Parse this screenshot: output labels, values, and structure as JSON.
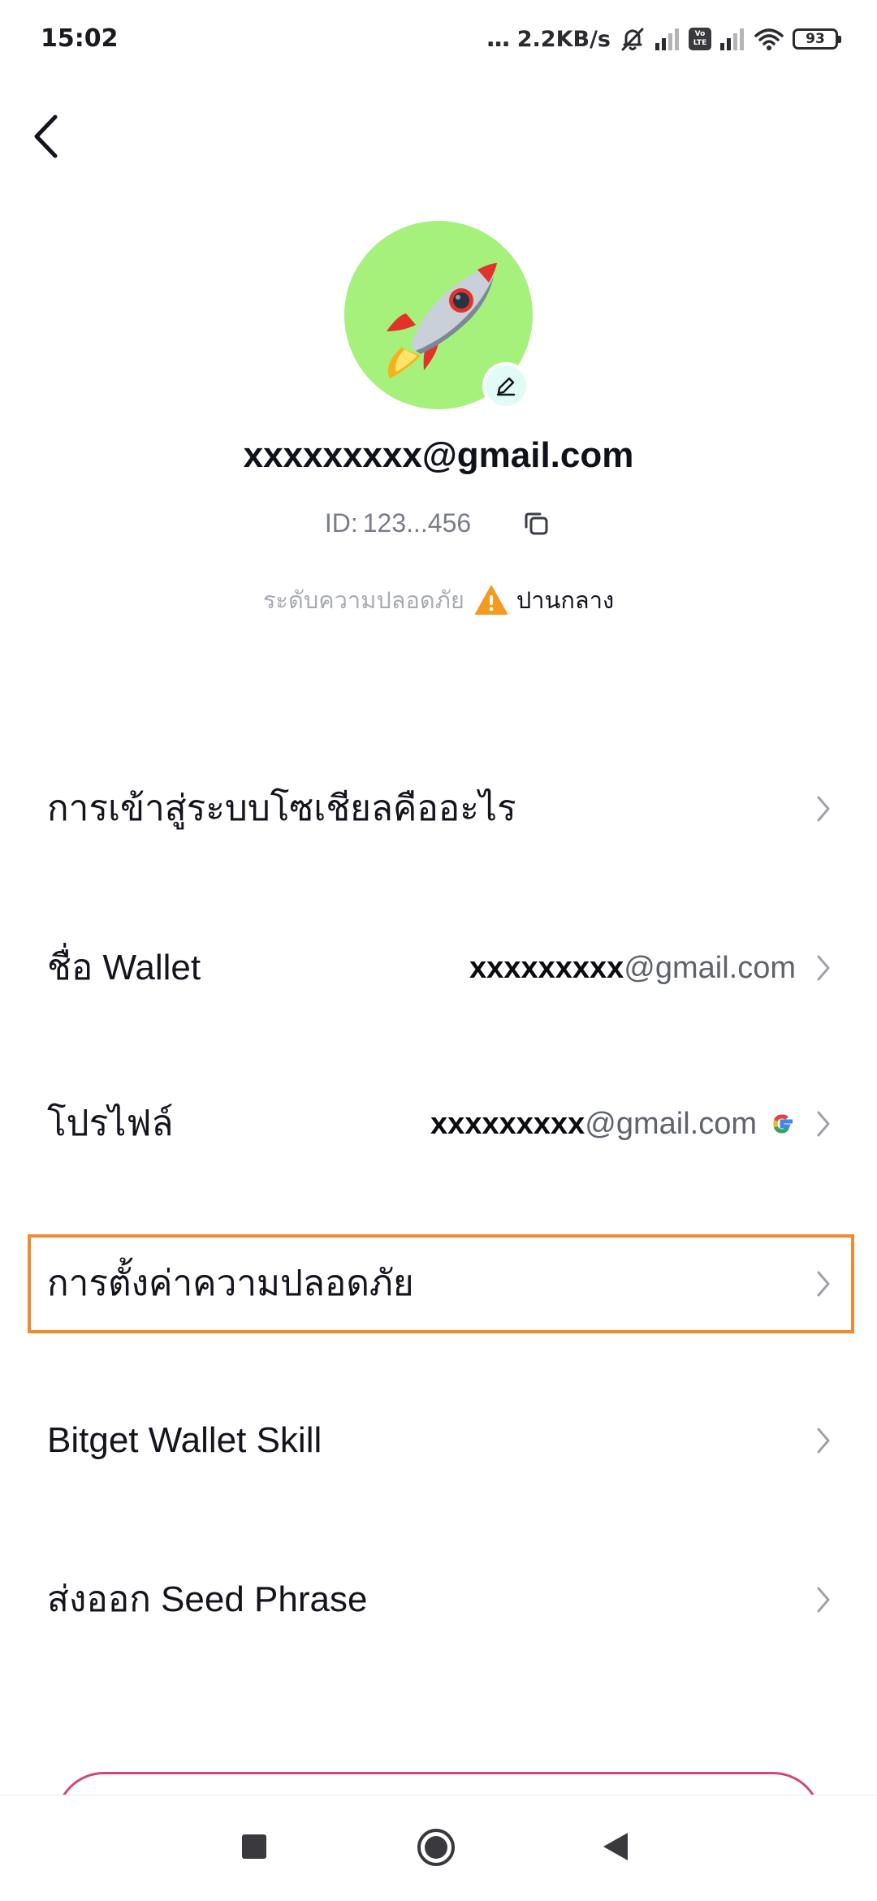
{
  "status_bar": {
    "time": "15:02",
    "dots": "...",
    "network_speed": "2.2KB/s",
    "volte": [
      "Vo",
      "LTE"
    ],
    "battery": "93",
    "icons": [
      "bell-muted-icon",
      "signal-icon",
      "volte-icon",
      "signal-icon",
      "wifi-icon",
      "battery-icon"
    ]
  },
  "header": {
    "back_icon": "chevron-left-icon"
  },
  "profile": {
    "avatar_icon": "rocket-icon",
    "avatar_color": "#a6f07c",
    "edit_icon": "pencil-icon",
    "email": "xxxxxxxxx@gmail.com",
    "id_label": "ID:",
    "id_value": "123...456",
    "copy_icon": "copy-icon",
    "security_label": "ระดับความปลอดภัย",
    "security_icon": "warning-icon",
    "security_level": "ปานกลาง"
  },
  "menu": {
    "items": [
      {
        "label": "การเข้าสู่ระบบโซเชียลคืออะไร"
      },
      {
        "label": "ชื่อ Wallet",
        "value_main": "xxxxxxxxx",
        "value_domain": "@gmail.com"
      },
      {
        "label": "โปรไฟล์",
        "value_main": "xxxxxxxxx",
        "value_domain": "@gmail.com",
        "value_icon": "google-icon"
      },
      {
        "label": "การตั้งค่าความปลอดภัย",
        "highlighted": true,
        "highlight_color": "#f08a30"
      },
      {
        "label": "Bitget Wallet Skill"
      },
      {
        "label": "ส่งออก Seed Phrase"
      }
    ]
  },
  "nav_bar": {
    "icons": [
      "recent-apps-icon",
      "home-icon",
      "back-triangle-icon"
    ]
  }
}
